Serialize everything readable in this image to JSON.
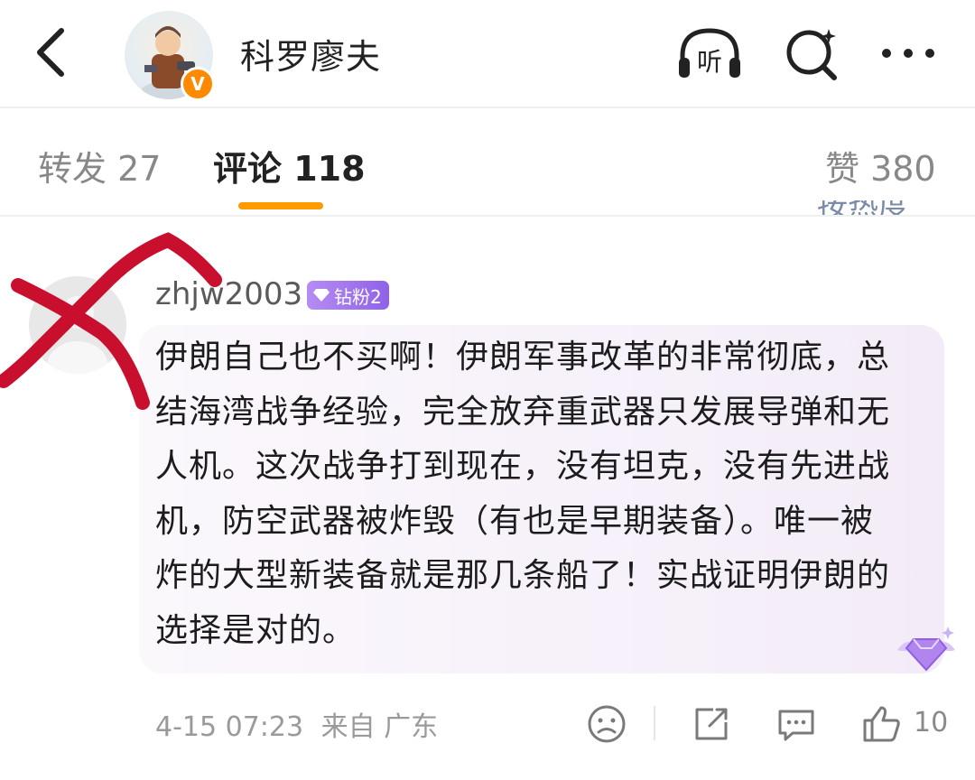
{
  "header": {
    "title": "科罗廖夫",
    "verified_badge": "V",
    "icons": [
      "back-icon",
      "listen-icon",
      "search-icon",
      "more-icon"
    ],
    "listen_icon_text": "听"
  },
  "tabs": [
    {
      "label": "转发 27",
      "active": false
    },
    {
      "label": "评论 118",
      "active": true
    },
    {
      "label": "赞 380",
      "active": false
    }
  ],
  "partial_text_top": "按热度",
  "comment": {
    "username": "zhjw2003",
    "fan_badge": "钻粉2",
    "text": "伊朗自己也不买啊！伊朗军事改革的非常彻底，总结海湾战争经验，完全放弃重武器只发展导弹和无人机。这次战争打到现在，没有坦克，没有先进战机，防空武器被炸毁（有也是早期装备）。唯一被炸的大型新装备就是那几条船了！实战证明伊朗的选择是对的。",
    "timestamp": "4-15 07:23",
    "location": "来自 广东",
    "like_count": "10"
  },
  "colors": {
    "accent": "#ff9a00",
    "badge_purple": "#9b6cf0",
    "annotation_red": "#c8102e"
  }
}
